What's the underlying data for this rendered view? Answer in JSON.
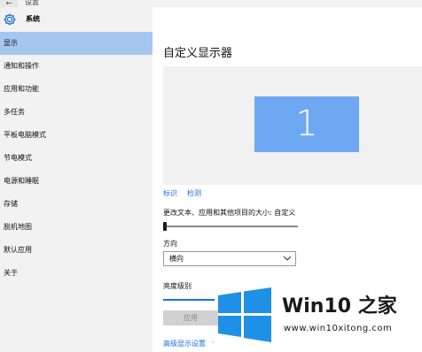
{
  "window": {
    "back_glyph": "←",
    "title": "设置"
  },
  "sidebar": {
    "header": "系统",
    "items": [
      {
        "label": "显示",
        "active": true
      },
      {
        "label": "通知和操作",
        "active": false
      },
      {
        "label": "应用和功能",
        "active": false
      },
      {
        "label": "多任务",
        "active": false
      },
      {
        "label": "平板电脑模式",
        "active": false
      },
      {
        "label": "节电模式",
        "active": false
      },
      {
        "label": "电源和睡眠",
        "active": false
      },
      {
        "label": "存储",
        "active": false
      },
      {
        "label": "脱机地图",
        "active": false
      },
      {
        "label": "默认应用",
        "active": false
      },
      {
        "label": "关于",
        "active": false
      }
    ]
  },
  "main": {
    "title": "自定义显示器",
    "monitor_number": "1",
    "links": {
      "identify": "标识",
      "detect": "检测"
    },
    "scale_label": "更改文本、应用和其他项目的大小: 自定义",
    "scale_value": 0,
    "orientation_label": "方向",
    "orientation_value": "横向",
    "brightness_label": "亮度级别",
    "apply_label": "应用",
    "advanced_link": "高级显示设置",
    "advanced_dot": "·"
  },
  "watermark": {
    "brand": "Win10 之家",
    "url": "www.win10xitong.com"
  },
  "colors": {
    "accent": "#1a73e8",
    "sidebar_bg": "#f2f2f2",
    "sidebar_active": "#a6c6f0",
    "monitor_tile": "#6fa8f2",
    "link": "#1a6fd8",
    "logo_blue": "#1e90e6"
  }
}
